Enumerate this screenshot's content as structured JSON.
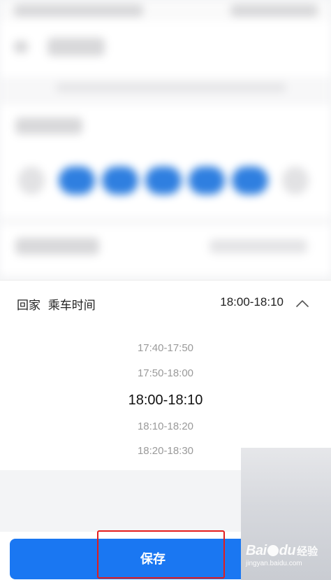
{
  "section": {
    "title_part1": "回家",
    "title_part2": "乘车时间",
    "selected_value": "18:00-18:10",
    "toggle_icon": "chevron-up-icon"
  },
  "picker": {
    "options": [
      "17:40-17:50",
      "17:50-18:00",
      "18:00-18:10",
      "18:10-18:20",
      "18:20-18:30"
    ],
    "selected": "18:00-18:10"
  },
  "footer": {
    "save_label": "保存"
  },
  "watermark": {
    "brand": "Bai",
    "brand_tail": "du",
    "cn": "经验",
    "url": "jingyan.baidu.com"
  },
  "colors": {
    "accent": "#1a77f2",
    "highlight": "#e31d1d"
  }
}
